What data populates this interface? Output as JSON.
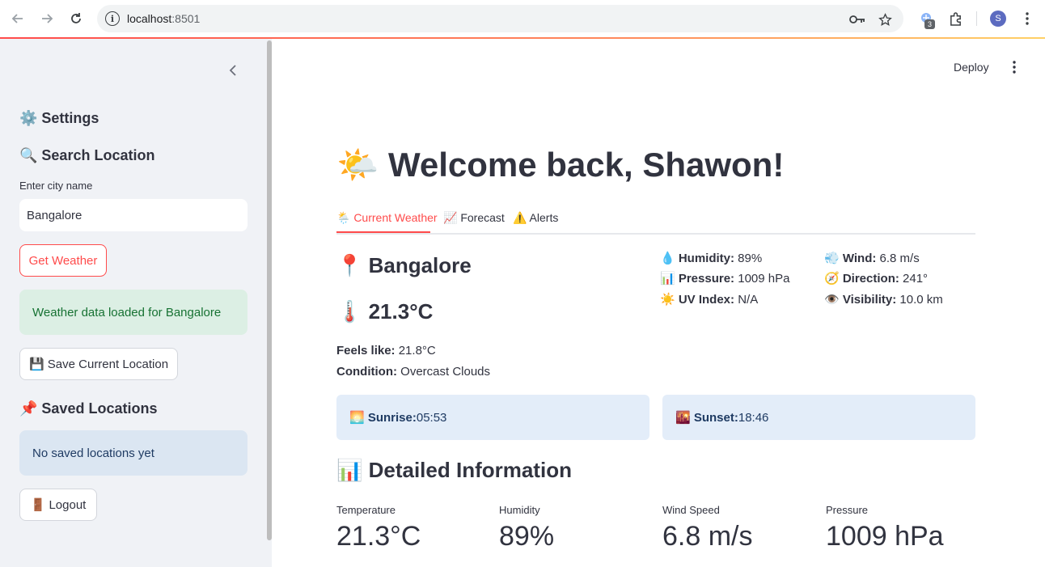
{
  "browser": {
    "url_host": "localhost",
    "url_port": ":8501",
    "extension_badge": "3",
    "profile_initial": "S"
  },
  "sidebar": {
    "settings_title": "⚙️ Settings",
    "search_title": "🔍 Search Location",
    "city_label": "Enter city name",
    "city_value": "Bangalore",
    "get_weather_label": "Get Weather",
    "success_message": "Weather data loaded for Bangalore",
    "save_location_label": "💾 Save Current Location",
    "saved_title": "📌 Saved Locations",
    "saved_empty_message": "No saved locations yet",
    "logout_label": "🚪 Logout"
  },
  "header": {
    "deploy_label": "Deploy"
  },
  "main": {
    "welcome_title": "🌤️ Welcome back, Shawon!",
    "tabs": [
      {
        "label": "🌦️ Current Weather"
      },
      {
        "label": "📈 Forecast"
      },
      {
        "label": "⚠️ Alerts"
      }
    ],
    "city_heading": "📍 Bangalore",
    "temp_heading": "🌡️ 21.3°C",
    "feels_like_label": "Feels like:",
    "feels_like_value": " 21.8°C",
    "condition_label": "Condition:",
    "condition_value": " Overcast Clouds",
    "stats": {
      "humidity_label": "💧 Humidity:",
      "humidity_value": " 89%",
      "pressure_label": "📊 Pressure:",
      "pressure_value": " 1009 hPa",
      "uv_label": "☀️ UV Index:",
      "uv_value": " N/A",
      "wind_label": "💨 Wind:",
      "wind_value": " 6.8 m/s",
      "direction_label": "🧭 Direction:",
      "direction_value": " 241°",
      "visibility_label": "👁️ Visibility:",
      "visibility_value": " 10.0 km"
    },
    "sunrise_label": "🌅 Sunrise:",
    "sunrise_value": " 05:53",
    "sunset_label": "🌇 Sunset:",
    "sunset_value": " 18:46",
    "detailed_title": "📊 Detailed Information",
    "metrics": [
      {
        "label": "Temperature",
        "value": "21.3°C"
      },
      {
        "label": "Humidity",
        "value": "89%"
      },
      {
        "label": "Wind Speed",
        "value": "6.8 m/s"
      },
      {
        "label": "Pressure",
        "value": "1009 hPa"
      }
    ]
  },
  "colors": {
    "accent": "#ff4b4b",
    "sidebar_bg": "#f0f2f6",
    "success_bg": "#dcefe4",
    "info_bg": "#dbe6f2"
  }
}
